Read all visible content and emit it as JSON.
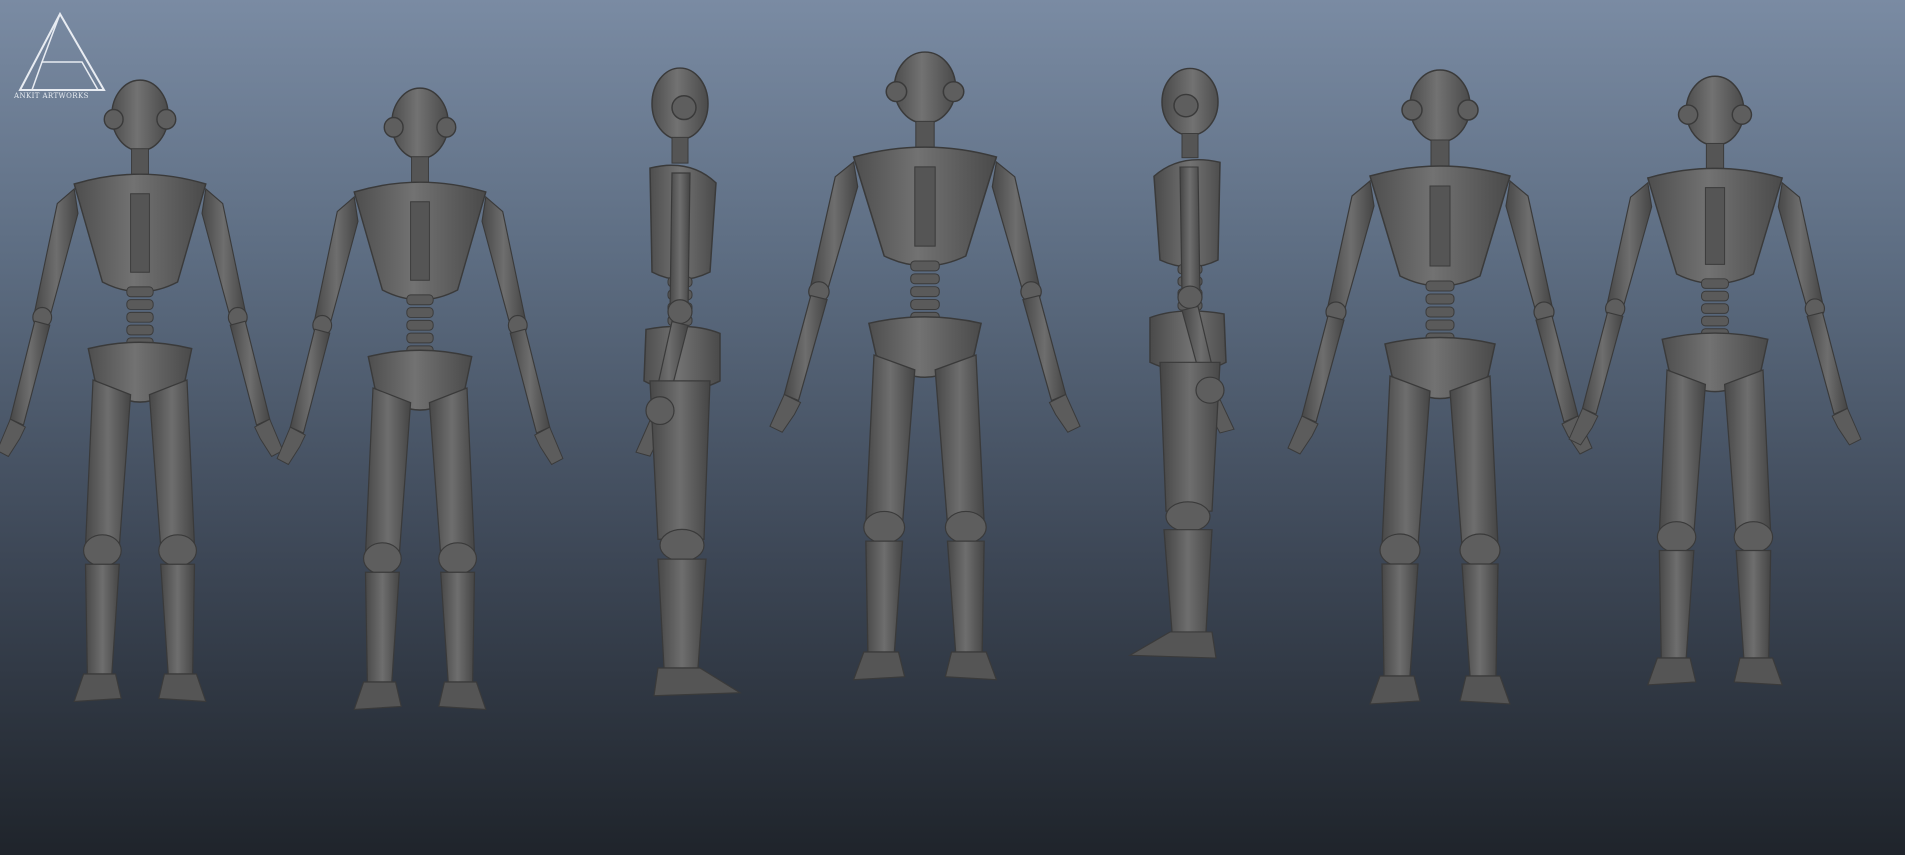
{
  "logo": {
    "text": "ANKIT ARTWORKS",
    "color": "#e8ecf2"
  },
  "scene": {
    "background_top": "#7a8ba3",
    "background_bottom": "#1f242b",
    "model_color": "#6a6a6a",
    "model_shadow": "#4a4a4a",
    "model_highlight": "#8a8a8a",
    "views": [
      {
        "view": "three-quarter-front-left"
      },
      {
        "view": "three-quarter-back-left"
      },
      {
        "view": "side-right"
      },
      {
        "view": "front"
      },
      {
        "view": "side-left"
      },
      {
        "view": "three-quarter-back-right"
      },
      {
        "view": "three-quarter-front-right"
      }
    ]
  }
}
